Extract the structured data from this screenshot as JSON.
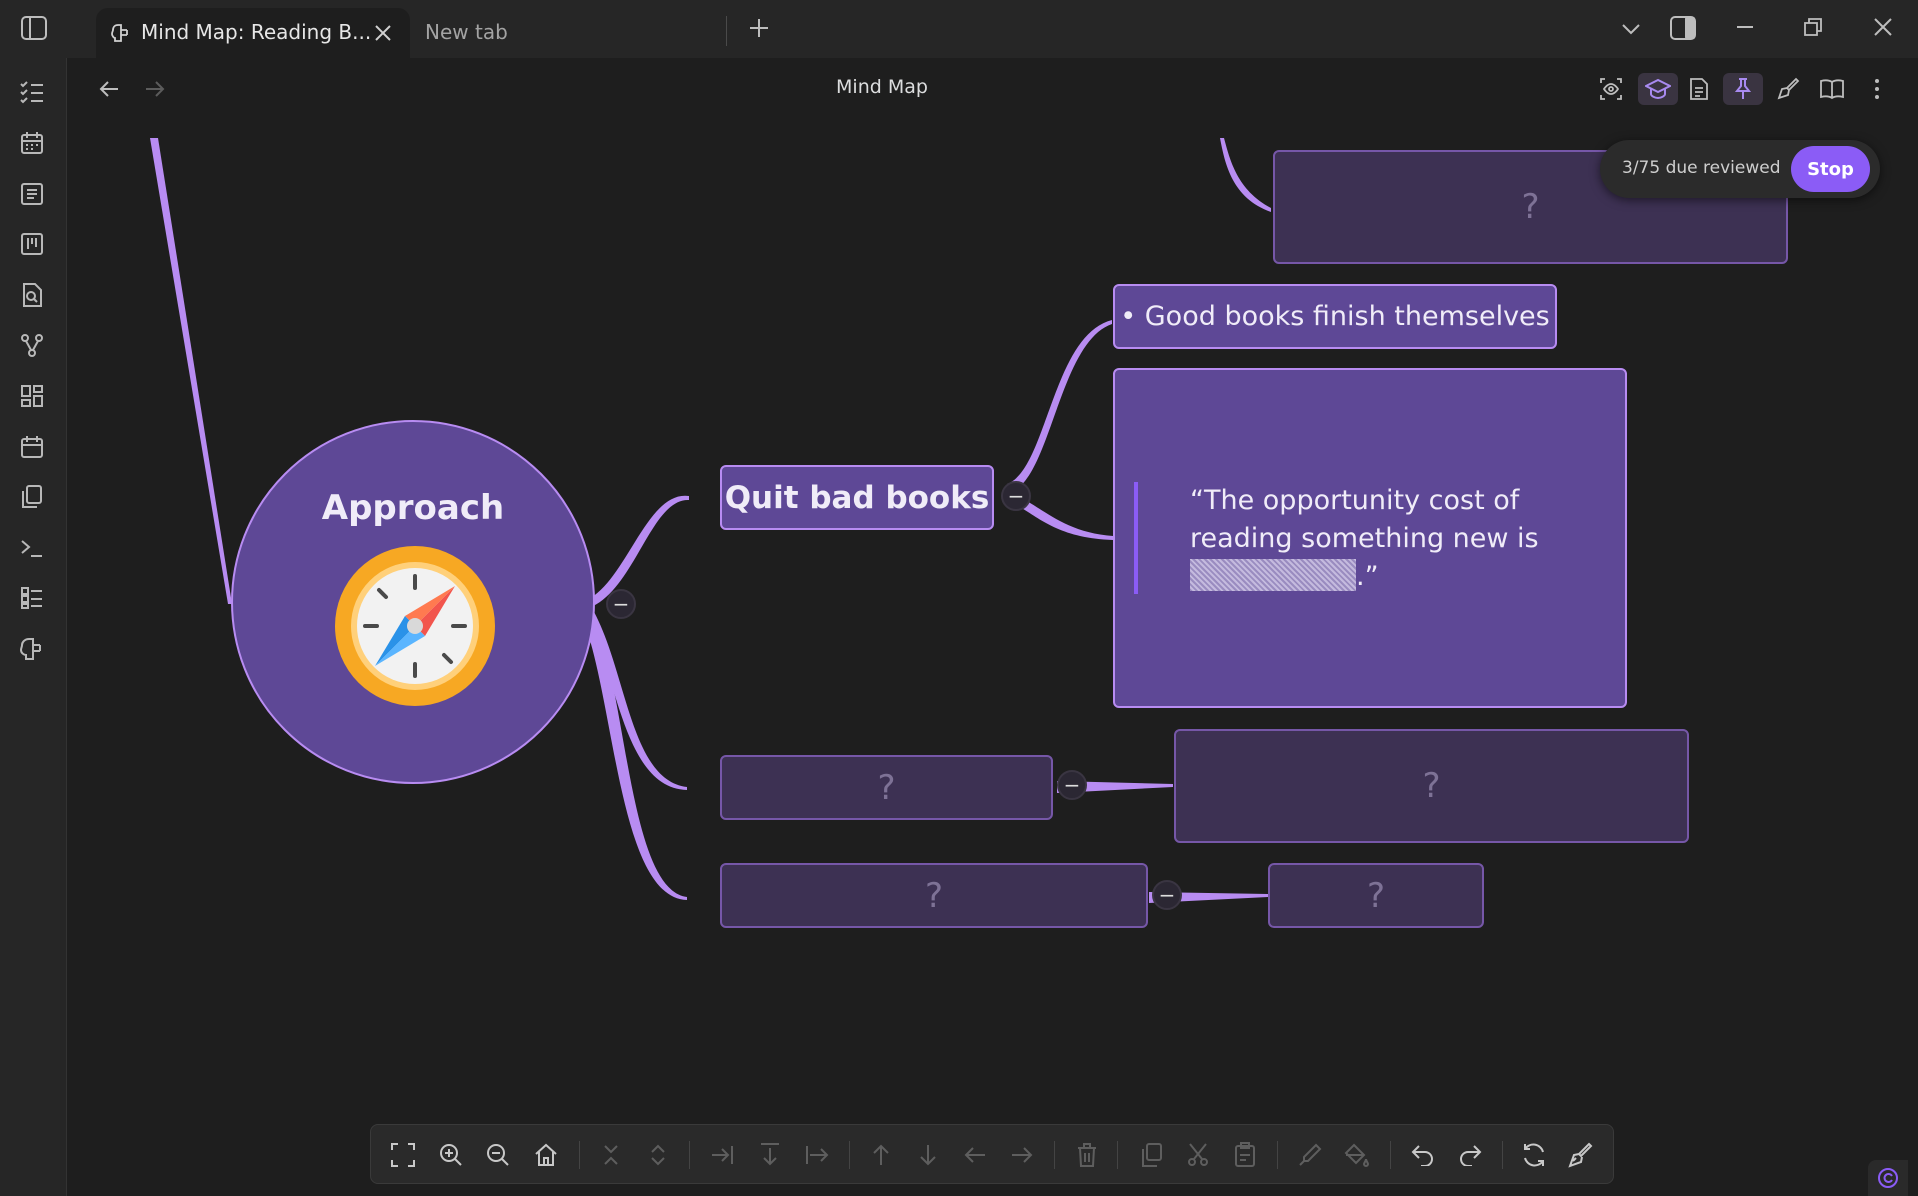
{
  "tabs": [
    {
      "label": "Mind Map: Reading B..."
    },
    {
      "label": "New tab"
    }
  ],
  "view": {
    "title": "Mind Map"
  },
  "review": {
    "status": "3/75 due reviewed",
    "stop_label": "Stop"
  },
  "mindmap": {
    "central": "Approach",
    "branch_quit": "Quit bad books",
    "leaf_good": "• Good books finish themselves",
    "quote_line1": "“The opportunity cost of",
    "quote_line2": "reading something new is",
    "quote_end": ".”",
    "hidden": "?"
  },
  "colors": {
    "accent": "#8b5cf6",
    "node_fill": "#5e4896",
    "node_border": "#b88cf2",
    "hidden_fill": "#3d3153",
    "background": "#1e1e1e"
  },
  "ribbon_icons": [
    "checklist-icon",
    "calendar-icon",
    "page-icon",
    "kanban-icon",
    "file-search-icon",
    "graph-icon",
    "dashboard-icon",
    "calendar-icon",
    "copy-icon",
    "terminal-icon",
    "list-icon",
    "brain-icon"
  ],
  "toolbar_icons": [
    "fullscreen-icon",
    "zoom-in-icon",
    "zoom-out-icon",
    "home-icon",
    "collapse-icon",
    "expand-icon",
    "add-child-icon",
    "add-sibling-icon",
    "add-parent-icon",
    "move-up-icon",
    "move-down-icon",
    "move-left-icon",
    "move-right-icon",
    "delete-icon",
    "copy-icon",
    "cut-icon",
    "paste-icon",
    "pen-icon",
    "paint-bucket-icon",
    "undo-icon",
    "redo-icon",
    "refresh-icon",
    "brush-icon"
  ]
}
